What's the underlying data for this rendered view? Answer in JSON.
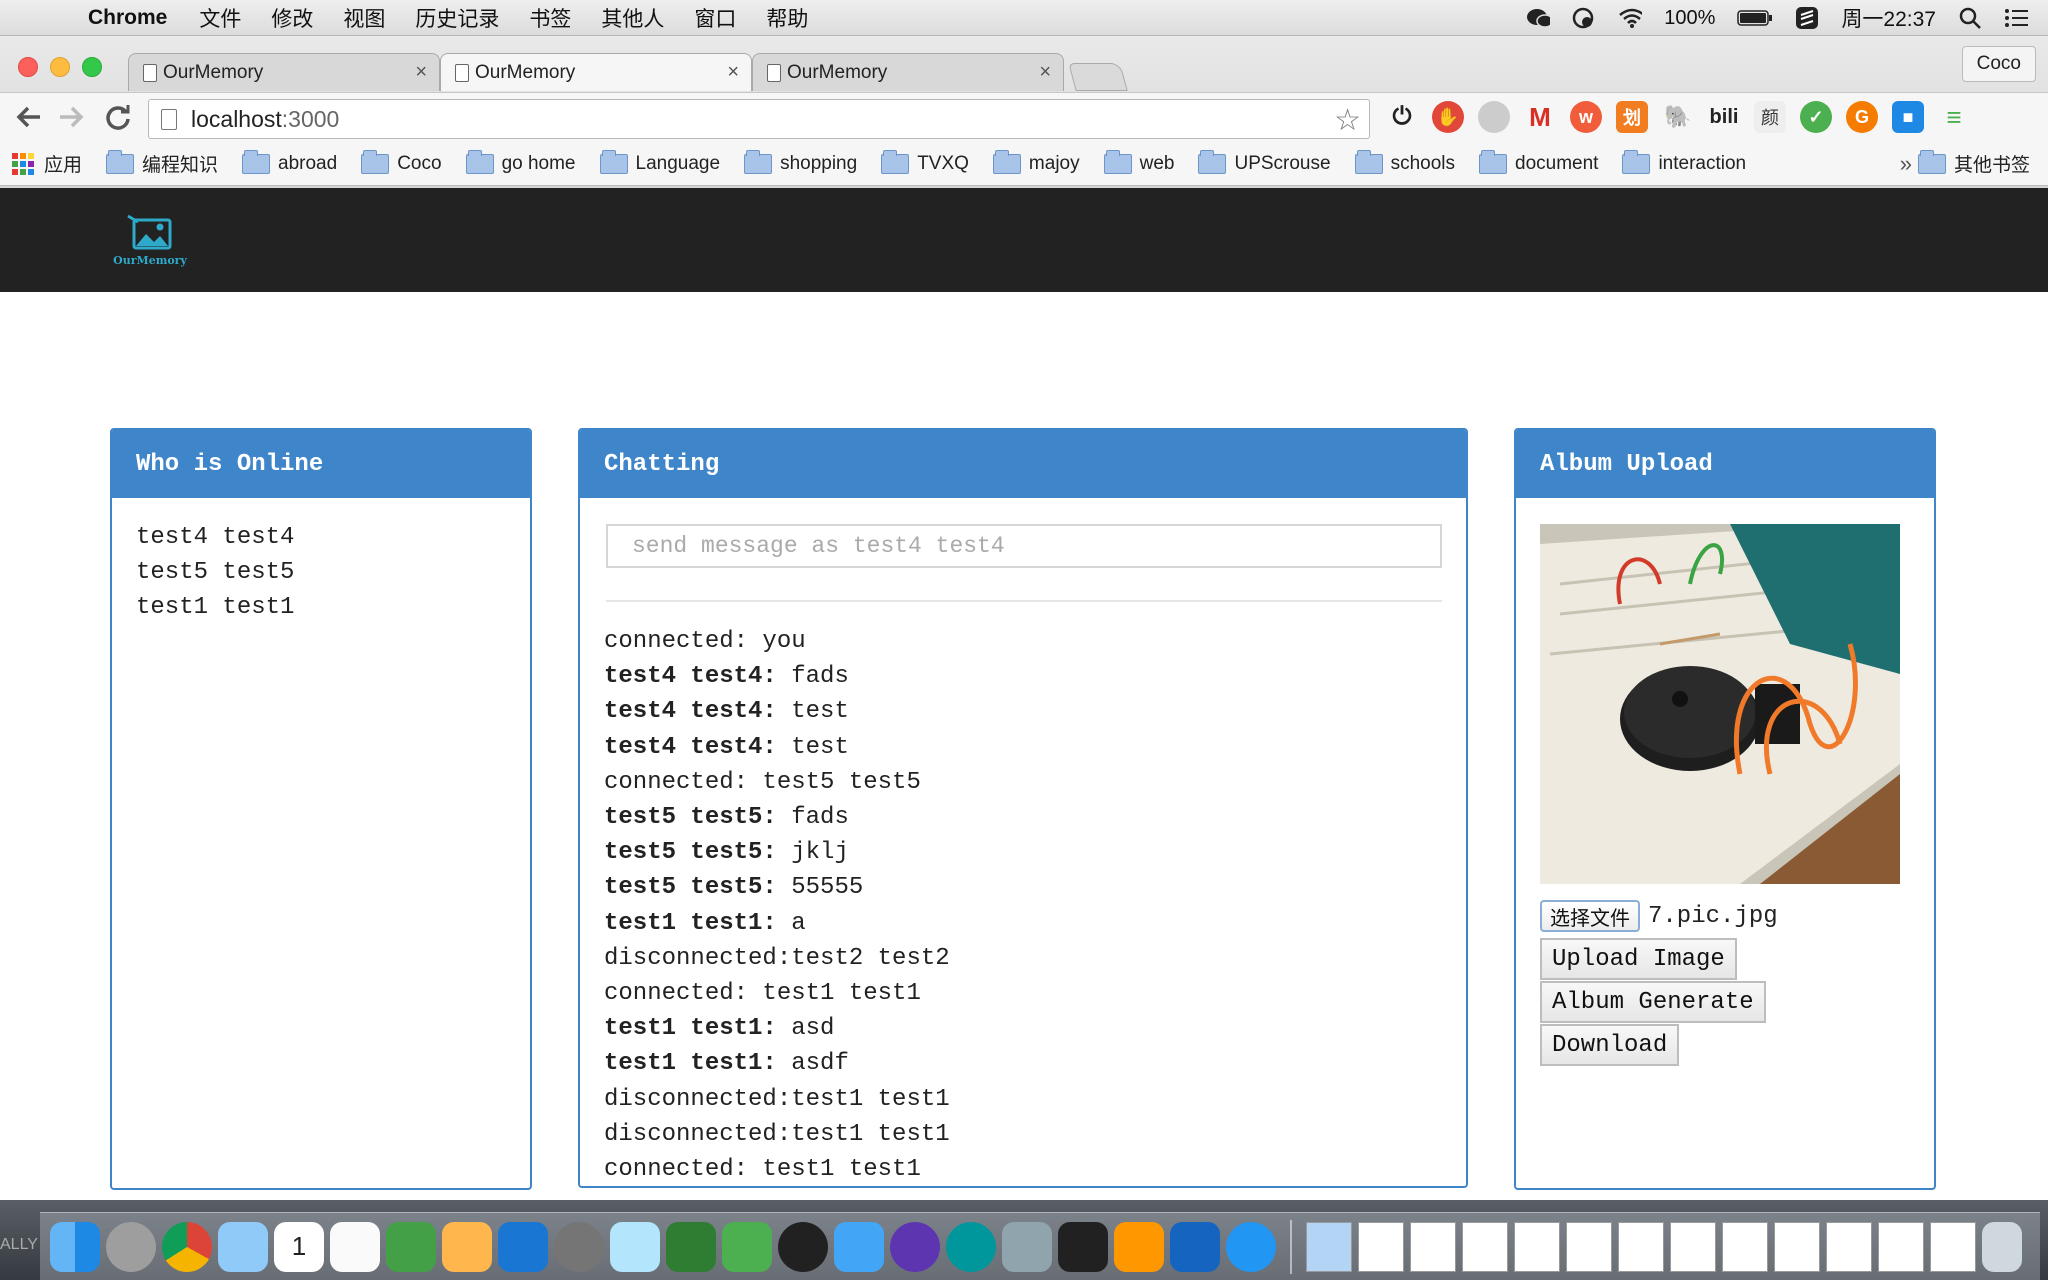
{
  "menubar": {
    "app": "Chrome",
    "items": [
      "文件",
      "修改",
      "视图",
      "历史记录",
      "书签",
      "其他人",
      "窗口",
      "帮助"
    ],
    "battery": "100%",
    "clock": "周一22:37"
  },
  "browser": {
    "tabs": [
      {
        "title": "OurMemory",
        "active": false
      },
      {
        "title": "OurMemory",
        "active": true
      },
      {
        "title": "OurMemory",
        "active": false
      }
    ],
    "profile": "Coco",
    "url_host": "localhost",
    "url_port": ":3000",
    "bookmarks": {
      "apps": "应用",
      "folders": [
        "编程知识",
        "abroad",
        "Coco",
        "go home",
        "Language",
        "shopping",
        "TVXQ",
        "majoy",
        "web",
        "UPScrouse",
        "schools",
        "document",
        "interaction"
      ],
      "more": "»",
      "other": "其他书签"
    }
  },
  "site": {
    "logo_text": "OurMemory"
  },
  "online": {
    "title": "Who is Online",
    "users": [
      "test4 test4",
      "test5 test5",
      "test1 test1"
    ]
  },
  "chat": {
    "title": "Chatting",
    "placeholder": "send message as test4 test4",
    "messages": [
      {
        "user": "",
        "text": "connected: you"
      },
      {
        "user": "test4 test4:",
        "text": " fads"
      },
      {
        "user": "test4 test4:",
        "text": " test"
      },
      {
        "user": "test4 test4:",
        "text": " test"
      },
      {
        "user": "",
        "text": "connected: test5 test5"
      },
      {
        "user": "test5 test5:",
        "text": " fads"
      },
      {
        "user": "test5 test5:",
        "text": " jklj"
      },
      {
        "user": "test5 test5:",
        "text": " 55555"
      },
      {
        "user": "test1 test1:",
        "text": " a"
      },
      {
        "user": "",
        "text": "disconnected:test2 test2"
      },
      {
        "user": "",
        "text": "connected: test1 test1"
      },
      {
        "user": "test1 test1:",
        "text": " asd"
      },
      {
        "user": "test1 test1:",
        "text": " asdf"
      },
      {
        "user": "",
        "text": "disconnected:test1 test1"
      },
      {
        "user": "",
        "text": "disconnected:test1 test1"
      },
      {
        "user": "",
        "text": "connected: test1 test1"
      }
    ]
  },
  "album": {
    "title": "Album Upload",
    "choose_file": "选择文件",
    "file_name": "7.pic.jpg",
    "upload": "Upload Image",
    "generate": "Album Generate",
    "download": "Download"
  },
  "dock": {
    "ally_label": "ALLY",
    "calendar_day": "1"
  }
}
